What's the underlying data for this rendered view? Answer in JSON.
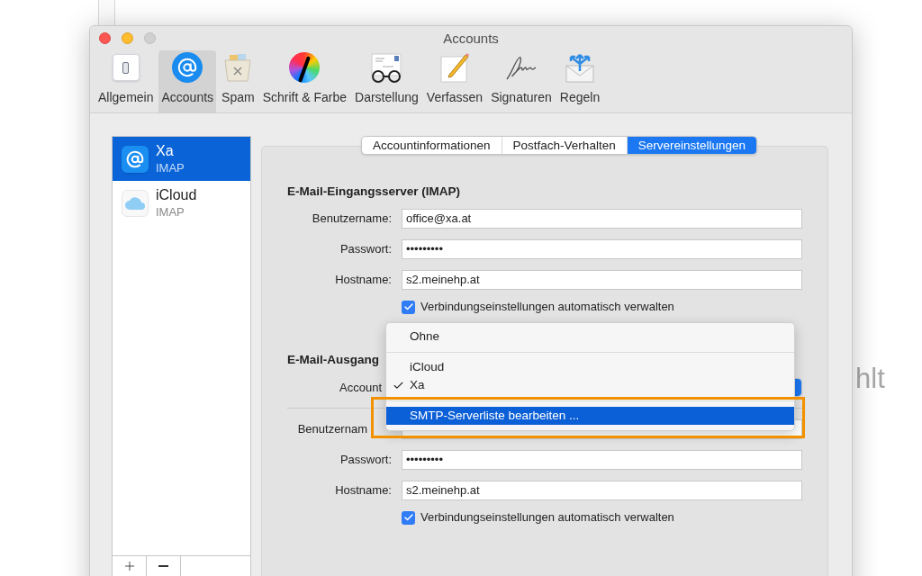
{
  "background": {
    "text": "hlt"
  },
  "window": {
    "title": "Accounts"
  },
  "toolbar": [
    {
      "label": "Allgemein",
      "kind": "switch",
      "selected": false
    },
    {
      "label": "Accounts",
      "kind": "at",
      "selected": true
    },
    {
      "label": "Spam",
      "kind": "bin",
      "selected": false
    },
    {
      "label": "Schrift & Farbe",
      "kind": "colors",
      "selected": false
    },
    {
      "label": "Darstellung",
      "kind": "glasses",
      "selected": false
    },
    {
      "label": "Verfassen",
      "kind": "pencil",
      "selected": false
    },
    {
      "label": "Signaturen",
      "kind": "signature",
      "selected": false
    },
    {
      "label": "Regeln",
      "kind": "rules",
      "selected": false
    }
  ],
  "accounts": [
    {
      "name": "Xa",
      "type": "IMAP",
      "kind": "at",
      "selected": true
    },
    {
      "name": "iCloud",
      "type": "IMAP",
      "kind": "cloud",
      "selected": false
    }
  ],
  "list_buttons": [
    {
      "kind": "add"
    },
    {
      "kind": "remove"
    }
  ],
  "tabs": [
    {
      "label": "Accountinformationen",
      "selected": false
    },
    {
      "label": "Postfach-Verhalten",
      "selected": false
    },
    {
      "label": "Servereinstellungen",
      "selected": true
    }
  ],
  "incoming": {
    "heading": "E-Mail-Eingangsserver (IMAP)",
    "fields": [
      {
        "label": "Benutzername:",
        "value": "office@xa.at"
      },
      {
        "label": "Passwort:",
        "value": "•••••••••"
      },
      {
        "label": "Hostname:",
        "value": "s2.meinehp.at"
      }
    ],
    "auto_manage": {
      "label": "Verbindungseinstellungen automatisch verwalten",
      "checked": true
    }
  },
  "outgoing": {
    "heading": "E-Mail-Ausgang",
    "account_label": "Account",
    "fields": [
      {
        "label": "Benutzernam"
      },
      {
        "label": "Passwort:",
        "value": "•••••••••"
      },
      {
        "label": "Hostname:",
        "value": "s2.meinehp.at"
      }
    ],
    "auto_manage": {
      "label": "Verbindungseinstellungen automatisch verwalten",
      "checked": true
    }
  },
  "menu": {
    "items": [
      {
        "kind": "item",
        "label": "Ohne",
        "checked": false,
        "selected": false
      },
      {
        "kind": "separator"
      },
      {
        "kind": "item",
        "label": "iCloud",
        "checked": false,
        "selected": false
      },
      {
        "kind": "item",
        "label": "Xa",
        "checked": true,
        "selected": false
      },
      {
        "kind": "separator"
      },
      {
        "kind": "item",
        "label": "SMTP-Serverliste bearbeiten ...",
        "checked": false,
        "selected": true
      }
    ]
  }
}
